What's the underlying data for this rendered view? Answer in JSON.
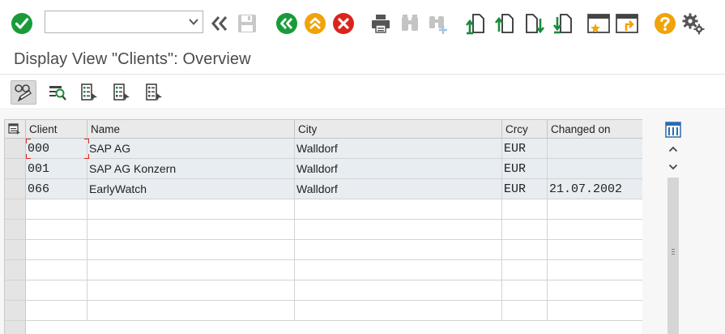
{
  "toolbar": {
    "command_field": {
      "value": "",
      "placeholder": ""
    }
  },
  "title": "Display View \"Clients\": Overview",
  "table": {
    "columns": [
      "Client",
      "Name",
      "City",
      "Crcy",
      "Changed on"
    ],
    "rows": [
      {
        "client": "000",
        "name": "SAP AG",
        "city": "Walldorf",
        "crcy": "EUR",
        "changed_on": ""
      },
      {
        "client": "001",
        "name": "SAP AG Konzern",
        "city": "Walldorf",
        "crcy": "EUR",
        "changed_on": ""
      },
      {
        "client": "066",
        "name": "EarlyWatch",
        "city": "Walldorf",
        "crcy": "EUR",
        "changed_on": "21.07.2002"
      }
    ]
  },
  "colors": {
    "enter_green": "#1a9b3a",
    "back_green": "#1a9b3a",
    "exit_orange": "#f0a30a",
    "cancel_red": "#d9251d",
    "help_orange": "#f0a30a",
    "transfer_green": "#1b8a3a",
    "row_fill": "#e8edf2"
  }
}
